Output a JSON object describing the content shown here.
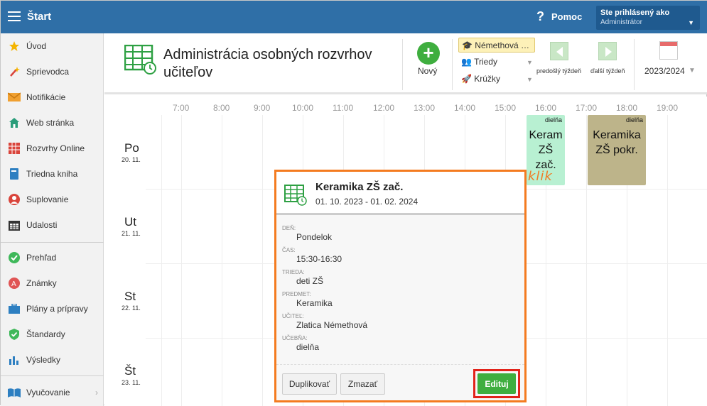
{
  "topbar": {
    "start_label": "Štart",
    "help_label": "Pomoc",
    "help_icon": "?",
    "user_line1": "Ste prihlásený ako",
    "user_line2": "Administrátor"
  },
  "sidebar": {
    "items": [
      {
        "label": "Úvod",
        "icon": "star-icon"
      },
      {
        "label": "Sprievodca",
        "icon": "magic-wand-icon"
      },
      {
        "label": "Notifikácie",
        "icon": "envelope-icon"
      },
      {
        "label": "Web stránka",
        "icon": "house-icon"
      },
      {
        "label": "Rozvrhy Online",
        "icon": "grid-icon"
      },
      {
        "label": "Triedna kniha",
        "icon": "book-icon"
      },
      {
        "label": "Suplovanie",
        "icon": "person-icon"
      },
      {
        "label": "Udalosti",
        "icon": "calendar-icon"
      },
      {
        "label": "Prehľad",
        "icon": "check-circle-icon"
      },
      {
        "label": "Známky",
        "icon": "grade-icon"
      },
      {
        "label": "Plány a prípravy",
        "icon": "briefcase-icon"
      },
      {
        "label": "Štandardy",
        "icon": "shield-check-icon"
      },
      {
        "label": "Výsledky",
        "icon": "bar-chart-icon"
      },
      {
        "label": "Vyučovanie",
        "icon": "open-book-icon"
      }
    ]
  },
  "header": {
    "title": "Administrácia osobných rozvrhov učiteľov",
    "new_label": "Nový",
    "teacher_filter": "Némethová …",
    "classes_filter": "Triedy",
    "clubs_filter": "Krúžky",
    "prev_week": "predošlý týždeň",
    "next_week": "ďalší týždeň",
    "year": "2023/2024"
  },
  "timetable": {
    "hours": [
      "7:00",
      "8:00",
      "9:00",
      "10:00",
      "11:00",
      "12:00",
      "13:00",
      "14:00",
      "15:00",
      "16:00",
      "17:00",
      "18:00",
      "19:00"
    ],
    "days": [
      {
        "name": "Po",
        "date": "20. 11."
      },
      {
        "name": "Ut",
        "date": "21. 11."
      },
      {
        "name": "St",
        "date": "22. 11."
      },
      {
        "name": "Št",
        "date": "23. 11."
      }
    ],
    "events": [
      {
        "room": "dielňa",
        "name": "Keram ZŠ zač.",
        "color": "#b8f0d2"
      },
      {
        "room": "dielňa",
        "name": "Keramika ZŠ pokr.",
        "color": "#bdb48a"
      }
    ],
    "annotation": "klik"
  },
  "popup": {
    "title": "Keramika ZŠ zač.",
    "range": "01. 10. 2023 - 01. 02. 2024",
    "fields": [
      {
        "label": "DEŇ:",
        "value": "Pondelok"
      },
      {
        "label": "ČAS:",
        "value": "15:30-16:30"
      },
      {
        "label": "TRIEDA:",
        "value": "deti ZŠ"
      },
      {
        "label": "PREDMET:",
        "value": "Keramika"
      },
      {
        "label": "UČITEĽ:",
        "value": "Zlatica Némethová"
      },
      {
        "label": "UČEBŇA:",
        "value": "dielňa"
      }
    ],
    "duplicate_label": "Duplikovať",
    "delete_label": "Zmazať",
    "edit_label": "Edituj"
  },
  "colors": {
    "topbar": "#2f6fa7",
    "accent_green": "#3fae3f",
    "highlight_orange": "#f47b20",
    "highlight_red": "#e2231a"
  }
}
